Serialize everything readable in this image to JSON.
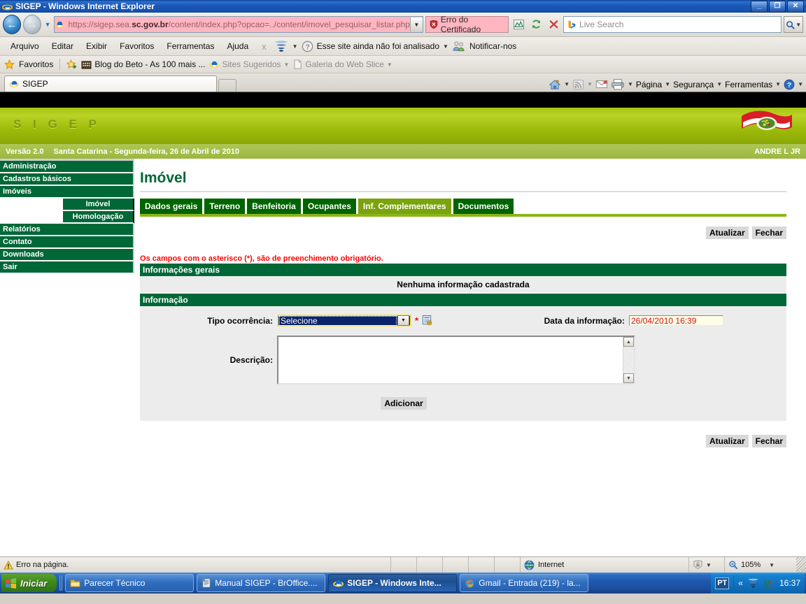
{
  "window": {
    "title": "SIGEP - Windows Internet Explorer",
    "minimize": "_",
    "restore": "❐",
    "close": "✕"
  },
  "browser": {
    "address": {
      "prefix": "https://sigep.sea.",
      "domain": "sc.gov.br",
      "path": "/content/index.php?opcao=../content/imovel_pesquisar_listar.php",
      "full": "https://sigep.sea.sc.gov.br/content/index.php?opcao=../content/imovel_pesquisar_listar.php"
    },
    "certificate_error": "Erro do Certificado",
    "search_placeholder": "Live Search",
    "menus": [
      "Arquivo",
      "Editar",
      "Exibir",
      "Favoritos",
      "Ferramentas",
      "Ajuda"
    ],
    "mcafee_status": "Esse site ainda não foi analisado",
    "report_label": "Notificar-nos",
    "favorites_label": "Favoritos",
    "fav_items": [
      "Blog do Beto - As 100 mais ...",
      "Sites Sugeridos",
      "Galeria do Web Slice"
    ],
    "tab_title": "SIGEP",
    "command_bar": [
      "Página",
      "Segurança",
      "Ferramentas"
    ]
  },
  "app": {
    "brand": "S I G E P",
    "version": "Versão 2.0",
    "location_date": "Santa Catarina - Segunda-feira, 26 de Abril de 2010",
    "user": "ANDRE L JR"
  },
  "sidebar": {
    "items": [
      {
        "label": "Administração",
        "level": 1
      },
      {
        "label": "Cadastros básicos",
        "level": 1
      },
      {
        "label": "Imóveis",
        "level": 1
      },
      {
        "label": "Imóvel",
        "level": 2
      },
      {
        "label": "Homologação",
        "level": 2
      },
      {
        "label": "Relatórios",
        "level": 1
      },
      {
        "label": "Contato",
        "level": 1
      },
      {
        "label": "Downloads",
        "level": 1
      },
      {
        "label": "Sair",
        "level": 1
      }
    ]
  },
  "main": {
    "page_title": "Imóvel",
    "tabs": [
      {
        "label": "Dados gerais",
        "active": false
      },
      {
        "label": "Terreno",
        "active": false
      },
      {
        "label": "Benfeitoria",
        "active": false
      },
      {
        "label": "Ocupantes",
        "active": false
      },
      {
        "label": "Inf. Complementares",
        "active": true
      },
      {
        "label": "Documentos",
        "active": false
      }
    ],
    "buttons": {
      "update": "Atualizar",
      "close": "Fechar"
    },
    "required_note": "Os campos com o asterisco (*), são de preenchimento obrigatório.",
    "sections": {
      "general_info": "Informações gerais",
      "empty_message": "Nenhuma informação cadastrada",
      "information": "Informação"
    },
    "form": {
      "occurrence_label": "Tipo ocorrência:",
      "occurrence_value": "Selecione",
      "required_marker": "*",
      "date_label": "Data da informação:",
      "date_value": "26/04/2010 16:39",
      "description_label": "Descrição:",
      "description_value": "",
      "add_button": "Adicionar"
    }
  },
  "statusbar": {
    "message": "Erro na página.",
    "zone": "Internet",
    "zoom": "105%"
  },
  "taskbar": {
    "start": "Iniciar",
    "items": [
      {
        "label": "Parecer Técnico",
        "active": false
      },
      {
        "label": "Manual SIGEP - BrOffice....",
        "active": false
      },
      {
        "label": "SIGEP - Windows Inte...",
        "active": true
      },
      {
        "label": "Gmail - Entrada (219) - la...",
        "active": false
      }
    ],
    "language": "PT",
    "clock": "16:37"
  },
  "colors": {
    "brand_green_dark": "#006837",
    "tab_green": "#006400",
    "tab_active_green": "#7aa30c",
    "header_green": "#a7c312",
    "required_red": "#ff0000",
    "date_text_red": "#d21414",
    "select_focus_bg": "#0a246a",
    "select_focus_border": "#f2e35c"
  }
}
